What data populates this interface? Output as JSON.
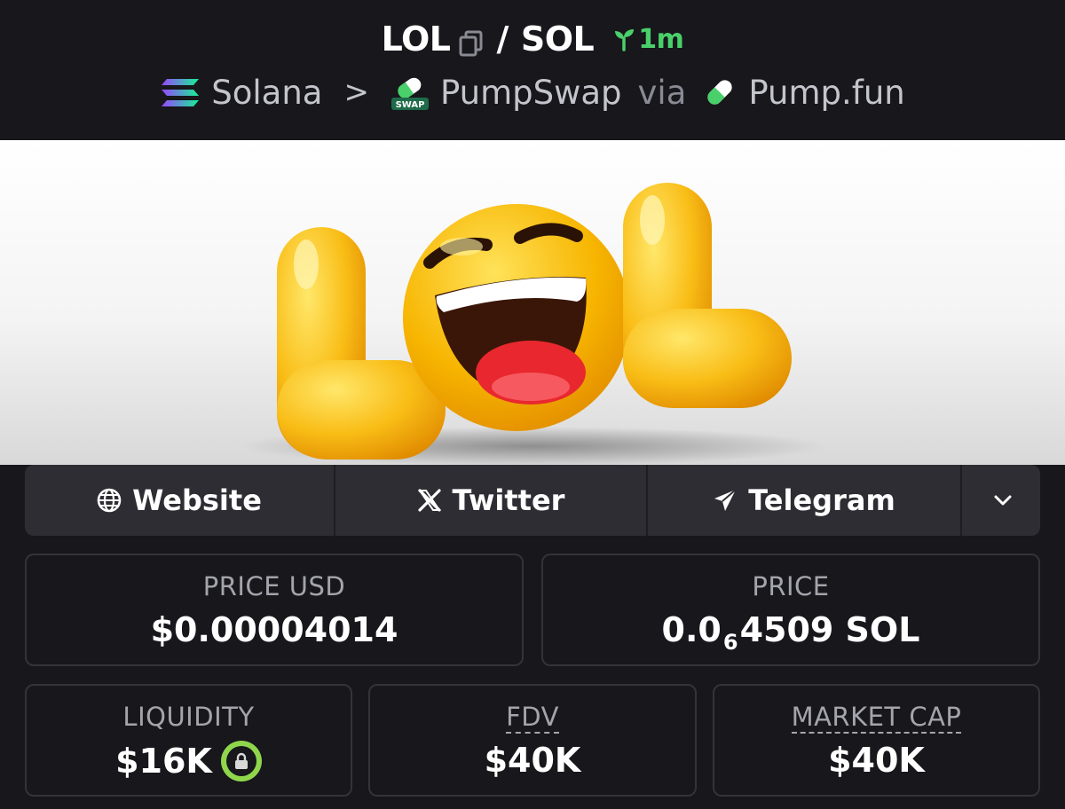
{
  "header": {
    "token": "LOL",
    "slash": "/",
    "quote": "SOL",
    "age": "1m",
    "chain": "Solana",
    "separator": ">",
    "dex": "PumpSwap",
    "via": "via",
    "launchpad": "Pump.fun",
    "swap_badge": "SWAP"
  },
  "links": {
    "website": "Website",
    "twitter": "Twitter",
    "telegram": "Telegram"
  },
  "stats": {
    "price_usd_label": "PRICE USD",
    "price_usd_value": "$0.00004014",
    "price_label": "PRICE",
    "price_prefix": "0.0",
    "price_zeros": "6",
    "price_suffix": "4509 SOL",
    "liquidity_label": "LIQUIDITY",
    "liquidity_value": "$16K",
    "fdv_label": "FDV",
    "fdv_value": "$40K",
    "mcap_label": "MARKET CAP",
    "mcap_value": "$40K"
  },
  "colors": {
    "background": "#17171c",
    "card_border": "#33333a",
    "link_bar": "#2d2d33",
    "age_green": "#4ad06a",
    "lock_green": "#8fd64c",
    "emoji_yellow": "#f7b500"
  },
  "icons": [
    "copy-icon",
    "sprout-icon",
    "solana-icon",
    "pumpswap-icon",
    "pumpfun-pill-icon",
    "globe-icon",
    "x-icon",
    "telegram-icon",
    "chevron-down-icon",
    "lock-icon"
  ]
}
